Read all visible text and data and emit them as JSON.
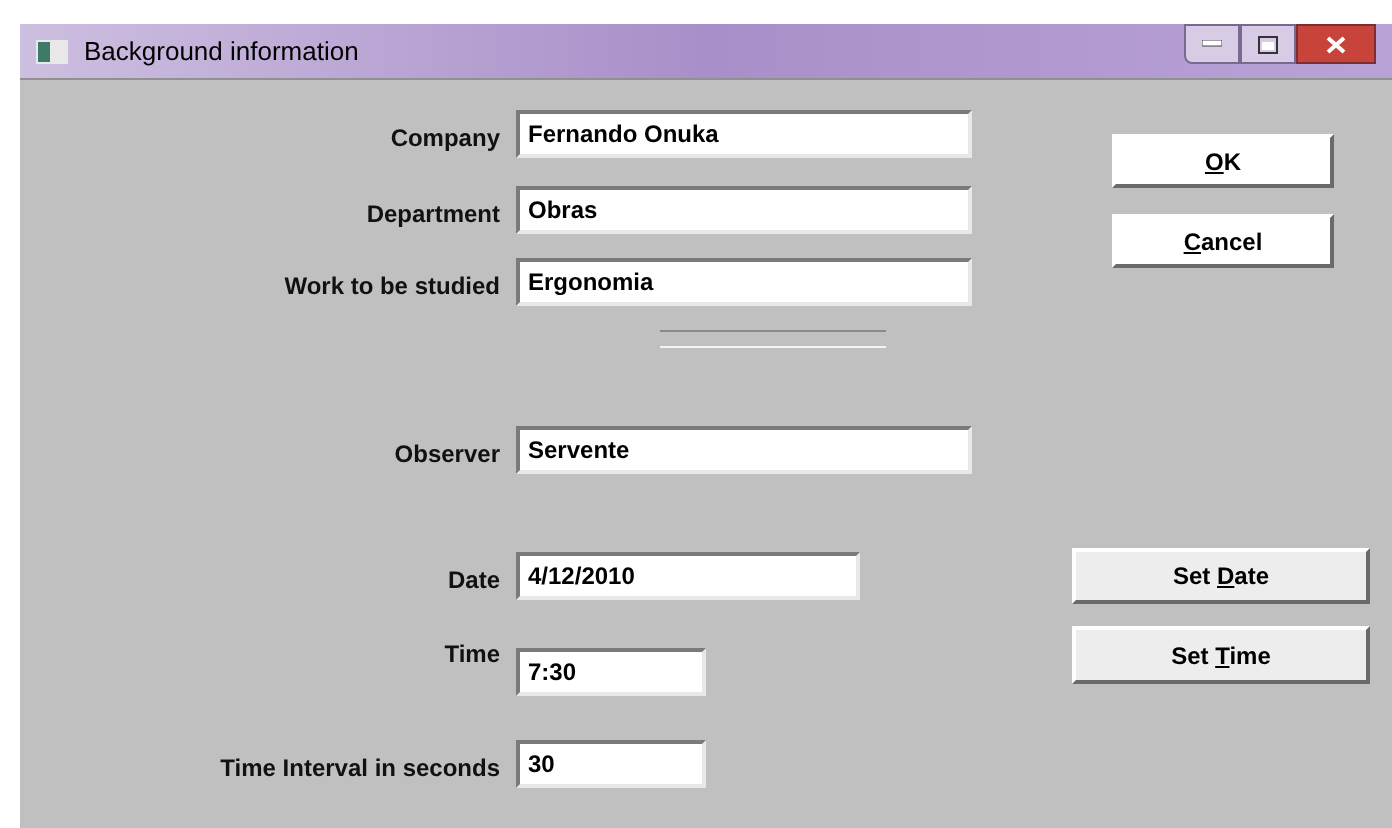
{
  "window": {
    "title": "Background information"
  },
  "fields": [
    {
      "label": "Company",
      "value": "Fernando Onuka"
    },
    {
      "label": "Department",
      "value": "Obras"
    },
    {
      "label": "Work to be studied",
      "value": "Ergonomia"
    },
    {
      "label": "Observer",
      "value": "Servente"
    },
    {
      "label": "Date",
      "value": "4/12/2010"
    },
    {
      "label": "Time",
      "value": "7:30"
    },
    {
      "label": "Time Interval in seconds",
      "value": "30"
    }
  ],
  "buttons": [
    {
      "key": "O",
      "after": "K"
    },
    {
      "key": "C",
      "after": "ancel"
    },
    {
      "before": "Set ",
      "key": "D",
      "after": "ate"
    },
    {
      "before": "Set ",
      "key": "T",
      "after": "ime"
    }
  ]
}
